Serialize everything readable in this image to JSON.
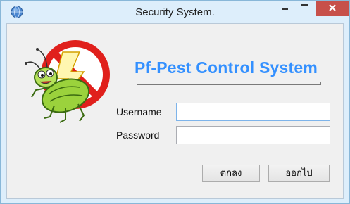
{
  "window": {
    "title": "Security System."
  },
  "header": {
    "heading": "Pf-Pest Control System"
  },
  "form": {
    "username_label": "Username",
    "username_value": "",
    "password_label": "Password",
    "password_value": ""
  },
  "buttons": {
    "ok_label": "ตกลง",
    "exit_label": "ออกไป"
  },
  "icons": {
    "app": "globe-icon",
    "logo": "pest-prohibited-logo",
    "minimize": "minimize-icon",
    "maximize": "maximize-icon",
    "close": "close-icon"
  },
  "colors": {
    "heading": "#3390ff",
    "close_button": "#c7504a",
    "titlebar": "#ddeefb",
    "client_background": "#f0f0f0"
  }
}
